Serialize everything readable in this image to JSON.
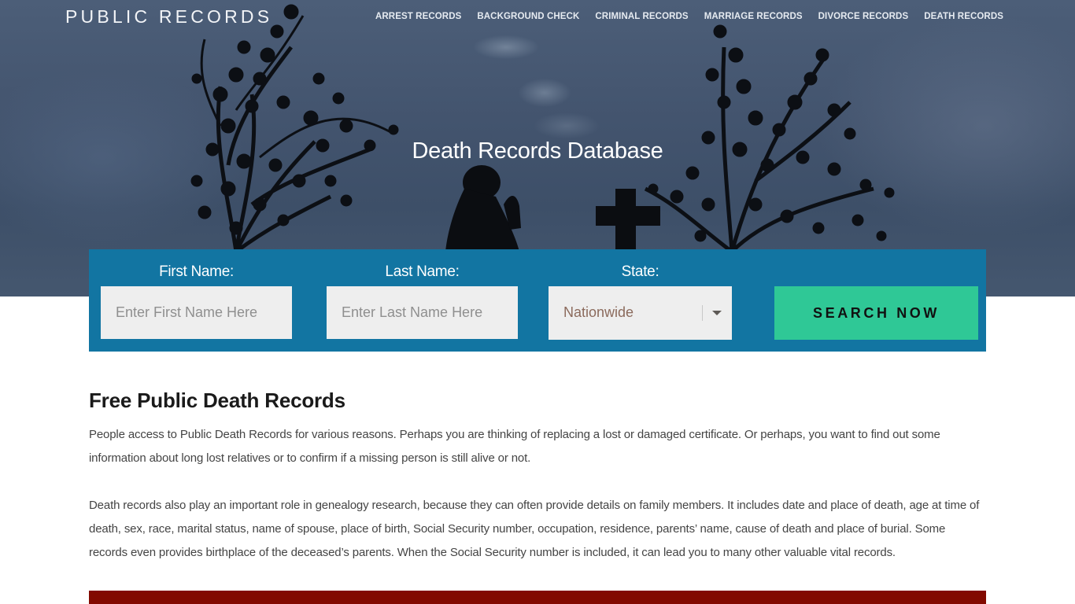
{
  "site": {
    "logo": "PUBLIC RECORDS"
  },
  "nav": {
    "items": [
      {
        "label": "ARREST RECORDS"
      },
      {
        "label": "BACKGROUND CHECK"
      },
      {
        "label": "CRIMINAL RECORDS"
      },
      {
        "label": "MARRIAGE RECORDS"
      },
      {
        "label": "DIVORCE RECORDS"
      },
      {
        "label": "DEATH RECORDS"
      }
    ]
  },
  "hero": {
    "title": "Death Records Database"
  },
  "search": {
    "first_name_label": "First Name:",
    "first_name_placeholder": "Enter First Name Here",
    "first_name_value": "",
    "last_name_label": "Last Name:",
    "last_name_placeholder": "Enter Last Name Here",
    "last_name_value": "",
    "state_label": "State:",
    "state_selected": "Nationwide",
    "button_label": "SEARCH NOW",
    "colors": {
      "box": "#1275a2",
      "button": "#2fc896",
      "input": "#eeeeee"
    }
  },
  "article": {
    "heading": "Free Public Death Records",
    "paragraphs": [
      "People access to Public Death Records for various reasons. Perhaps you are thinking of replacing a lost or damaged certificate. Or perhaps, you want to find out some information about long lost relatives or to confirm if a missing person is still alive or not.",
      "Death records also play an important role in genealogy research, because they can often provide details on family members. It includes date and place of death, age at time of death, sex, race, marital status, name of spouse, place of birth, Social Security number, occupation, residence, parents’ name, cause of death and place of burial. Some records even provides birthplace of the deceased’s parents. When the Social Security number is included, it can lead you to many other valuable vital records."
    ]
  },
  "colors": {
    "accent_band": "#820a00"
  }
}
